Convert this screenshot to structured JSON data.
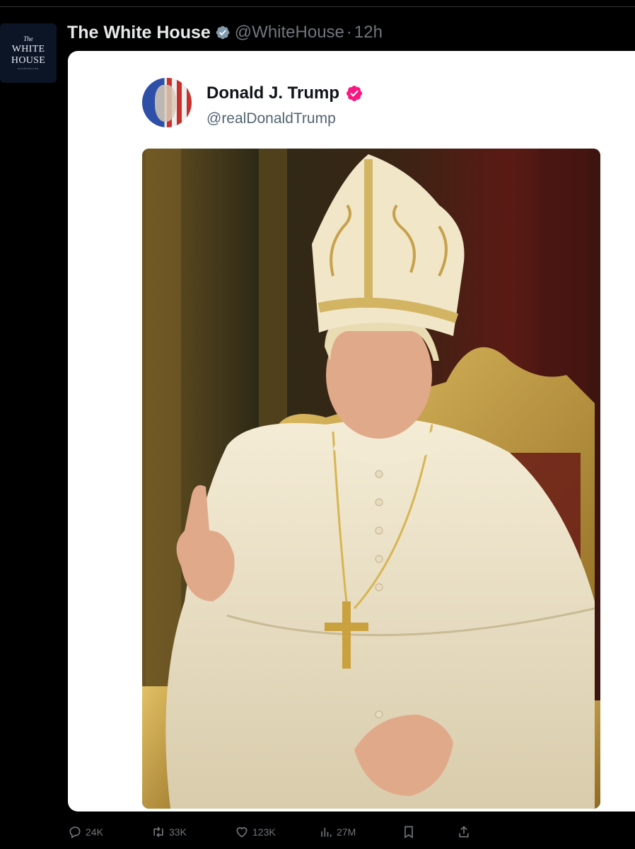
{
  "tweet": {
    "display_name": "The White House",
    "handle": "@WhiteHouse",
    "separator": "·",
    "time": "12h",
    "avatar": {
      "line1": "The",
      "line2": "WHITE",
      "line3": "HOUSE",
      "line4": "WASHINGTON"
    },
    "verified_color": "#829aab"
  },
  "embedded_post": {
    "display_name": "Donald J. Trump",
    "handle": "@realDonaldTrump",
    "badge_color": "#f91880"
  },
  "actions": {
    "replies": "24K",
    "reposts": "33K",
    "likes": "123K",
    "views": "27M"
  },
  "icons": {
    "reply": "reply-icon",
    "repost": "repost-icon",
    "like": "heart-icon",
    "views": "views-bar-chart-icon",
    "bookmark": "bookmark-icon",
    "share": "share-icon"
  }
}
